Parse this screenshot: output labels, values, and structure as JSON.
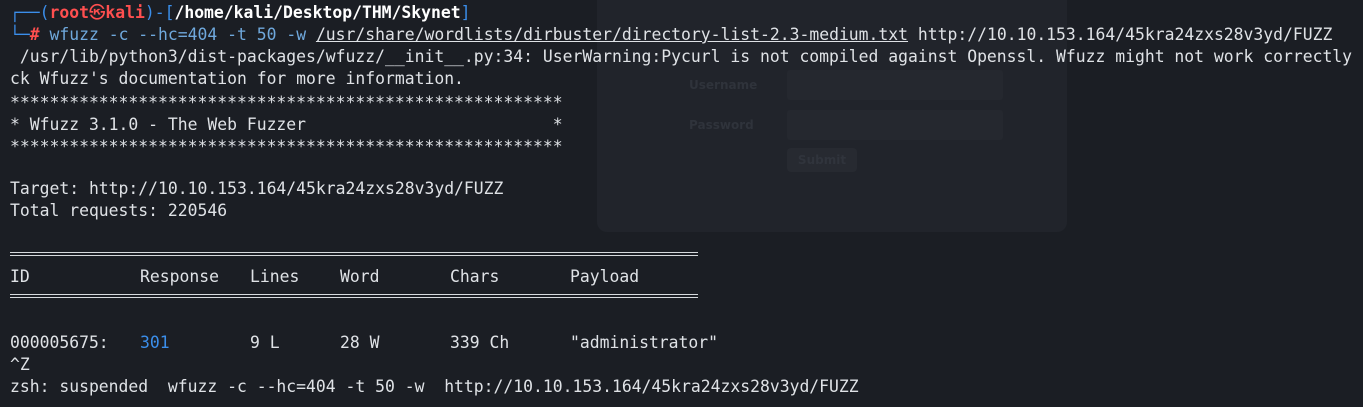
{
  "prompt": {
    "corner_top": "┌──(",
    "user": "root",
    "at_symbol": "㉿",
    "host": "kali",
    "sep": ")-[",
    "path": "/home/kali/Desktop/THM/Skynet",
    "close": "]",
    "corner_bottom": "└─",
    "hash": "#"
  },
  "command": {
    "base": "wfuzz -c --hc=404 -t 50 -w ",
    "wordlist": "/usr/share/wordlists/dirbuster/directory-list-2.3-medium.txt",
    "url": " http://10.10.153.164/45kra24zxs28v3yd/FUZZ"
  },
  "output": {
    "warning_1": " /usr/lib/python3/dist-packages/wfuzz/__init__.py:34: UserWarning:Pycurl is not compiled against Openssl. Wfuzz might not work correctly",
    "warning_2": "ck Wfuzz's documentation for more information.",
    "stars": "********************************************************",
    "banner": "* Wfuzz 3.1.0 - The Web Fuzzer                         *",
    "target": "Target: http://10.10.153.164/45kra24zxs28v3yd/FUZZ",
    "total": "Total requests: 220546"
  },
  "table": {
    "headers": [
      "ID",
      "Response",
      "Lines",
      "Word",
      "Chars",
      "Payload"
    ],
    "rows": [
      {
        "id": "000005675:",
        "response": "301",
        "lines": "9 L",
        "word": "28 W",
        "chars": "339 Ch",
        "payload": "\"administrator\""
      }
    ]
  },
  "footer": {
    "ctrl_z": "^Z",
    "suspended": "zsh: suspended  wfuzz -c --hc=404 -t 50 -w  http://10.10.153.164/45kra24zxs28v3yd/FUZZ"
  },
  "background_form": {
    "username_label": "Username",
    "password_label": "Password",
    "submit_label": "Submit"
  },
  "colors": {
    "background": "#1b1e24",
    "prompt_blue": "#3b8eea",
    "prompt_red": "#ff4f4f",
    "response_code": "#3b8eea"
  }
}
